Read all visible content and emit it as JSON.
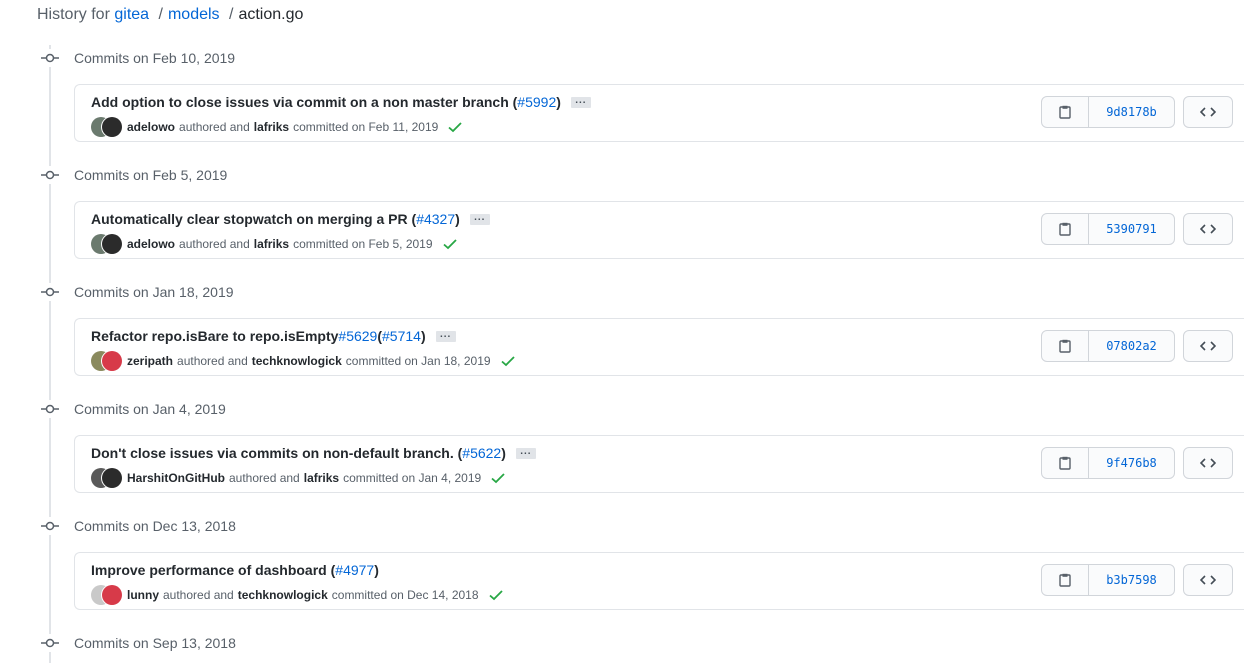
{
  "breadcrumb": {
    "prefix": "History for",
    "repo": "gitea",
    "sep1": "/",
    "folder": "models",
    "sep2": "/",
    "file": "action.go"
  },
  "groups": [
    {
      "title": "Commits on Feb 10, 2019",
      "commit": {
        "message": "Add option to close issues via commit on a non master branch (",
        "pr": "#5992",
        "close": ")",
        "author": "adelowo",
        "authored_text": "authored and",
        "committer": "lafriks",
        "committed_text": "committed on Feb 11, 2019",
        "sha": "9d8178b"
      }
    },
    {
      "title": "Commits on Feb 5, 2019",
      "commit": {
        "message": "Automatically clear stopwatch on merging a PR (",
        "pr": "#4327",
        "close": ")",
        "author": "adelowo",
        "authored_text": "authored and",
        "committer": "lafriks",
        "committed_text": "committed on Feb 5, 2019",
        "sha": "5390791"
      }
    },
    {
      "title": "Commits on Jan 18, 2019",
      "commit": {
        "message": "Refactor repo.isBare to repo.isEmpty ",
        "pr_a": "#5629",
        "mid": " (",
        "pr": "#5714",
        "close": ")",
        "author": "zeripath",
        "authored_text": "authored and",
        "committer": "techknowlogick",
        "committed_text": "committed on Jan 18, 2019",
        "sha": "07802a2"
      }
    },
    {
      "title": "Commits on Jan 4, 2019",
      "commit": {
        "message": "Don't close issues via commits on non-default branch. (",
        "pr": "#5622",
        "close": ")",
        "author": "HarshitOnGitHub",
        "authored_text": "authored and",
        "committer": "lafriks",
        "committed_text": "committed on Jan 4, 2019",
        "sha": "9f476b8"
      }
    },
    {
      "title": "Commits on Dec 13, 2018",
      "commit": {
        "message": "Improve performance of dashboard (",
        "pr": "#4977",
        "close": ")",
        "author": "lunny",
        "authored_text": "authored and",
        "committer": "techknowlogick",
        "committed_text": "committed on Dec 14, 2018",
        "sha": "b3b7598"
      }
    },
    {
      "title": "Commits on Sep 13, 2018"
    }
  ],
  "colors": {
    "link": "#0366d6",
    "check": "#28a745",
    "border": "#e1e4e8"
  },
  "icons": {
    "node": "git-commit-icon",
    "copy": "clipboard-icon",
    "browse": "code-icon",
    "status": "check-icon",
    "expand": "ellipsis-icon"
  },
  "ellipsis": "..."
}
